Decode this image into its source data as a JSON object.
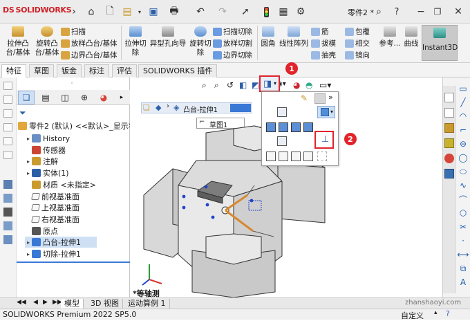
{
  "app": {
    "brand_prefix": "DS",
    "brand": "SOLIDWORKS",
    "doc_title": "零件2 *"
  },
  "command_bar": {
    "boss_extrude": "拉伸凸\n台/基体",
    "boss_revolve": "旋转凸\n台/基体",
    "sweep": "扫描",
    "loft": "放样凸台/基体",
    "boundary_boss": "边界凸台/基体",
    "cut_extrude": "拉伸切\n除",
    "hole_wizard": "异型孔向导",
    "cut_revolve": "旋转切\n除",
    "swept_cut": "扫描切除",
    "lofted_cut": "放样切割",
    "boundary_cut": "边界切除",
    "fillet": "圆角",
    "linear_pattern": "线性阵列",
    "rib": "筋",
    "draft": "拔模",
    "shell": "抽壳",
    "wrap": "包覆",
    "intersect": "相交",
    "mirror": "镜向",
    "ref_geometry": "参考...",
    "curves": "曲线",
    "instant3d": "Instant3D"
  },
  "tabs": [
    "特征",
    "草图",
    "钣金",
    "标注",
    "评估",
    "SOLIDWORKS 插件"
  ],
  "tree": {
    "root": "零件2 (默认) <<默认>_显示状",
    "items": [
      {
        "label": "History",
        "arrow": "▸"
      },
      {
        "label": "传感器",
        "arrow": ""
      },
      {
        "label": "注解",
        "arrow": "▸"
      },
      {
        "label": "实体(1)",
        "arrow": "▸"
      },
      {
        "label": "材质 <未指定>",
        "arrow": ""
      },
      {
        "label": "前视基准面",
        "arrow": ""
      },
      {
        "label": "上视基准面",
        "arrow": ""
      },
      {
        "label": "右视基准面",
        "arrow": ""
      },
      {
        "label": "原点",
        "arrow": ""
      },
      {
        "label": "凸台-拉伸1",
        "arrow": "▸"
      },
      {
        "label": "切除-拉伸1",
        "arrow": "▸"
      }
    ]
  },
  "breadcrumb": {
    "feature": "凸台-拉伸1",
    "sketch": "草图1"
  },
  "view_label": "*等轴测",
  "annotations": {
    "one": "1",
    "two": "2"
  },
  "bottom_tabs": [
    "模型",
    "3D 视图",
    "运动算例 1"
  ],
  "status": {
    "left": "SOLIDWORKS Premium 2022 SP5.0",
    "right": "自定义",
    "watermark": "zhanshaoyi.com"
  },
  "popup": {
    "more": "»"
  },
  "colors": {
    "accent_red": "#e1232b",
    "brand_red": "#d11f26",
    "selection_blue": "#3a78d6"
  }
}
